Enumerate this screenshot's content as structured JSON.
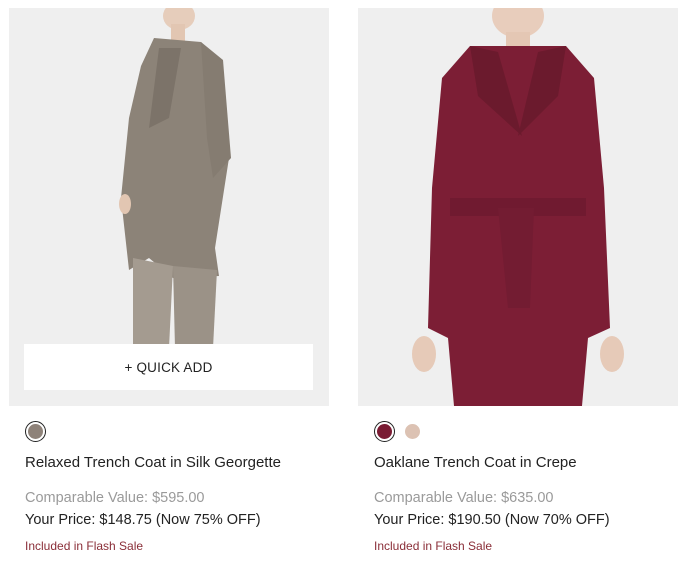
{
  "products": [
    {
      "name": "Relaxed Trench Coat in Silk Georgette",
      "comparable": "Comparable Value: $595.00",
      "price": "Your Price: $148.75 (Now 75% OFF)",
      "sale_note": "Included in Flash Sale",
      "quick_add": "+ QUICK ADD",
      "swatches": [
        "#8e8279"
      ],
      "coat_color": "#8c8378"
    },
    {
      "name": "Oaklane Trench Coat in Crepe",
      "comparable": "Comparable Value: $635.00",
      "price": "Your Price: $190.50 (Now 70% OFF)",
      "sale_note": "Included in Flash Sale",
      "swatches": [
        "#7a1b33",
        "#dcc2b3"
      ],
      "coat_color": "#7c1e35"
    }
  ]
}
